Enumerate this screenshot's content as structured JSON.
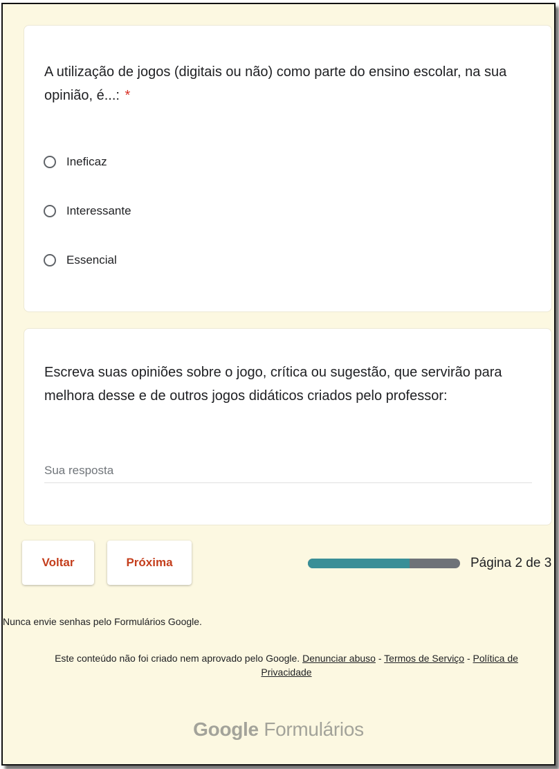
{
  "question1": {
    "title": "A utilização de jogos (digitais ou não) como parte do ensino escolar, na sua opinião, é...:",
    "required_mark": "*",
    "options": [
      {
        "label": "Ineficaz",
        "selected": false
      },
      {
        "label": "Interessante",
        "selected": false
      },
      {
        "label": "Essencial",
        "selected": false
      }
    ]
  },
  "question2": {
    "title": "Escreva suas opiniões sobre o jogo, crítica ou sugestão, que servirão para melhora desse e de outros jogos didáticos criados pelo professor:",
    "answer_placeholder": "Sua resposta",
    "answer_value": ""
  },
  "navigation": {
    "back_label": "Voltar",
    "next_label": "Próxima",
    "page_label": "Página 2 de 3",
    "progress_fraction": 0.667
  },
  "footer": {
    "warning": "Nunca envie senhas pelo Formulários Google.",
    "disclaimer_text": "Este conteúdo não foi criado nem aprovado pelo Google.",
    "report_abuse": "Denunciar abuso",
    "separator": "-",
    "terms": "Termos de Serviço",
    "privacy": "Política de Privacidade",
    "brand_google": "Google",
    "brand_forms": "Formulários"
  },
  "colors": {
    "background": "#fcf8e1",
    "accent": "#c43e1c",
    "progress_fill": "#3a8f97",
    "progress_track": "#6e7378",
    "required": "#d93025"
  }
}
